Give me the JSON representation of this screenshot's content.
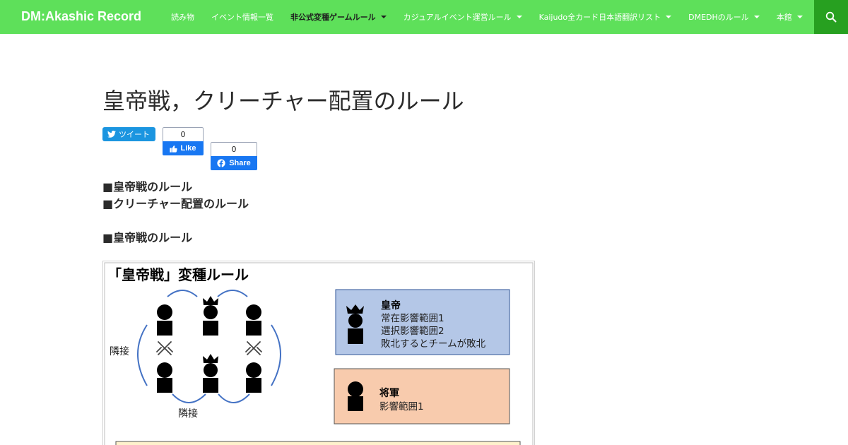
{
  "header": {
    "site_title": "DM:Akashic Record",
    "nav": [
      {
        "label": "読み物",
        "dropdown": false,
        "current": false
      },
      {
        "label": "イベント情報一覧",
        "dropdown": false,
        "current": false
      },
      {
        "label": "非公式変種ゲームルール",
        "dropdown": true,
        "current": true
      },
      {
        "label": "カジュアルイベント運営ルール",
        "dropdown": true,
        "current": false
      },
      {
        "label": "Kaijudo全カード日本語翻訳リスト",
        "dropdown": true,
        "current": false
      },
      {
        "label": "DMEDHのルール",
        "dropdown": true,
        "current": false
      },
      {
        "label": "本館",
        "dropdown": true,
        "current": false
      }
    ],
    "search_icon": "search-icon",
    "colors": {
      "bar": "#5ee05a",
      "search_bg": "#27a020"
    }
  },
  "article": {
    "title": "皇帝戦，クリーチャー配置のルール",
    "share": {
      "tweet_label": "ツイート",
      "like_count": "0",
      "like_label": "Like",
      "share_count": "0",
      "share_label": "Share"
    },
    "toc": [
      "■皇帝戦のルール",
      "■クリーチャー配置のルール"
    ],
    "section_heading": "■皇帝戦のルール",
    "figure": {
      "title": "「皇帝戦」変種ルール",
      "adjacent_side": "隣接",
      "adjacent_bottom": "隣接",
      "emperor_box": {
        "heading": "皇帝",
        "lines": [
          "常在影響範囲1",
          "選択影響範囲2",
          "敗北するとチームが敗北"
        ],
        "color": "#b4c7e7"
      },
      "general_box": {
        "heading": "将軍",
        "lines": [
          "影響範囲1"
        ],
        "color": "#f8cbad"
      }
    }
  }
}
